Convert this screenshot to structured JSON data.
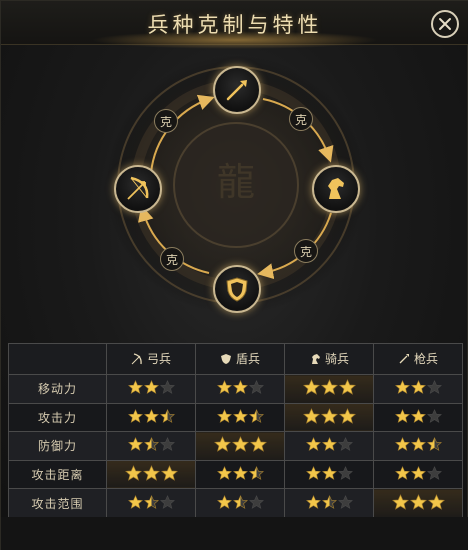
{
  "window": {
    "title": "兵种克制与特性"
  },
  "cycle": {
    "counter_label": "克",
    "units": [
      {
        "key": "spear",
        "icon": "spear-icon"
      },
      {
        "key": "cavalry",
        "icon": "horse-icon"
      },
      {
        "key": "shield",
        "icon": "shield-icon"
      },
      {
        "key": "archer",
        "icon": "bow-icon"
      }
    ]
  },
  "table": {
    "columns": [
      {
        "label": "弓兵",
        "icon": "bow-icon"
      },
      {
        "label": "盾兵",
        "icon": "shield-icon"
      },
      {
        "label": "骑兵",
        "icon": "horse-icon"
      },
      {
        "label": "枪兵",
        "icon": "spear-icon"
      }
    ],
    "rows": [
      {
        "label": "移动力",
        "ratings": [
          2,
          2,
          3,
          2
        ]
      },
      {
        "label": "攻击力",
        "ratings": [
          2.5,
          2.5,
          3,
          2
        ]
      },
      {
        "label": "防御力",
        "ratings": [
          1.5,
          3,
          2,
          2.5
        ]
      },
      {
        "label": "攻击距离",
        "ratings": [
          3,
          2.5,
          2,
          2
        ]
      },
      {
        "label": "攻击范围",
        "ratings": [
          1.5,
          1.5,
          1.5,
          3
        ]
      }
    ],
    "max_stars": 3
  },
  "colors": {
    "star_full": "#f2c64a",
    "star_empty": "#3d3d3d",
    "accent": "#e2b45c"
  }
}
